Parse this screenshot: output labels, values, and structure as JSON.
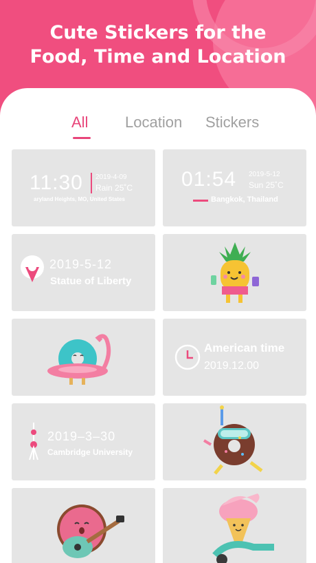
{
  "hero": {
    "title": "Cute Stickers for the Food, Time and Location"
  },
  "tabs": [
    {
      "label": "All"
    },
    {
      "label": "Location"
    },
    {
      "label": "Stickers"
    }
  ],
  "cards": {
    "time1": {
      "time": "11:30",
      "date": "2019-4-09",
      "weather": "Rain 25˚C",
      "place": "aryland Heights, MO, United States"
    },
    "time2": {
      "time": "01:54",
      "date": "2019-5-12",
      "weather": "Sun 25˚C",
      "place": "Bangkok, Thailand"
    },
    "loc1": {
      "date": "2019-5-12",
      "place": "Statue of Liberty"
    },
    "sticker_pineapple": {
      "icon": "pineapple-sticker-icon"
    },
    "sticker_donut_flamingo": {
      "icon": "donut-flamingo-sticker-icon"
    },
    "american": {
      "title": "American time",
      "date": "2019.12.00"
    },
    "loc2": {
      "date": "2019–3–30",
      "place": "Cambridge University"
    },
    "sticker_donut_snorkel": {
      "icon": "donut-snorkel-sticker-icon"
    },
    "sticker_donut_guitar": {
      "icon": "donut-guitar-sticker-icon"
    },
    "sticker_icecream": {
      "icon": "icecream-scooter-sticker-icon"
    }
  },
  "colors": {
    "brand": "#f04e7f",
    "accent": "#e8457a",
    "card": "#e5e5e5"
  }
}
